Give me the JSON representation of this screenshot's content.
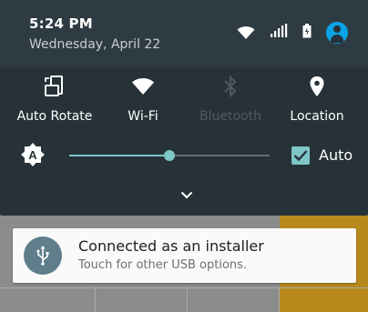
{
  "status_bar": {
    "time": "5:24 PM",
    "date": "Wednesday, April 22",
    "icons": [
      "wifi-icon",
      "signal-icon",
      "battery-icon",
      "account-icon"
    ]
  },
  "quick_settings": {
    "tiles": [
      {
        "label": "Auto Rotate",
        "icon": "auto-rotate-icon",
        "enabled": true
      },
      {
        "label": "Wi-Fi",
        "icon": "wifi-icon",
        "enabled": true
      },
      {
        "label": "Bluetooth",
        "icon": "bluetooth-icon",
        "enabled": false
      },
      {
        "label": "Location",
        "icon": "location-icon",
        "enabled": true
      }
    ],
    "brightness": {
      "icon": "brightness-auto-icon",
      "level": 0.5,
      "auto_checked": true,
      "auto_label": "Auto"
    },
    "expand_icon": "chevron-down-icon"
  },
  "notification": {
    "icon": "usb-icon",
    "title": "Connected as an installer",
    "text": "Touch for other USB options."
  },
  "colors": {
    "shade_bg": "#263238",
    "header_bg": "#2f3b42",
    "accent": "#7fc6c6",
    "usb_circle": "#607d8b",
    "avatar": "#0aa4e6"
  }
}
